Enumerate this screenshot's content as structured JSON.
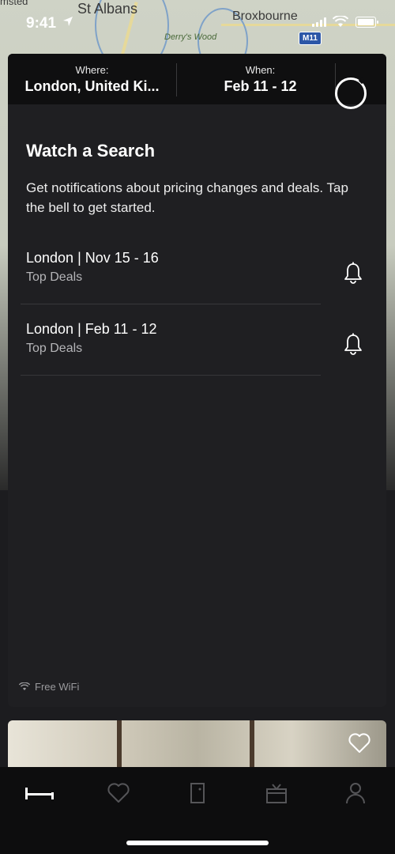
{
  "status_bar": {
    "time": "9:41"
  },
  "map": {
    "labels": [
      "St Albans",
      "Broxbourne",
      "Derry's Wood",
      "msted",
      "M11"
    ]
  },
  "search": {
    "where_label": "Where:",
    "where_value": "London, United Ki...",
    "when_label": "When:",
    "when_value": "Feb 11 - 12"
  },
  "watch": {
    "title": "Watch a Search",
    "description": "Get notifications about pricing changes and deals. Tap the bell to get started.",
    "items": [
      {
        "title": "London | Nov 15 - 16",
        "subtitle": "Top Deals"
      },
      {
        "title": "London | Feb 11 - 12",
        "subtitle": "Top Deals"
      }
    ]
  },
  "card": {
    "amenity": "Free WiFi"
  },
  "tabs": [
    {
      "icon": "bed-icon"
    },
    {
      "icon": "heart-icon"
    },
    {
      "icon": "door-icon"
    },
    {
      "icon": "gift-icon"
    },
    {
      "icon": "person-icon"
    }
  ]
}
